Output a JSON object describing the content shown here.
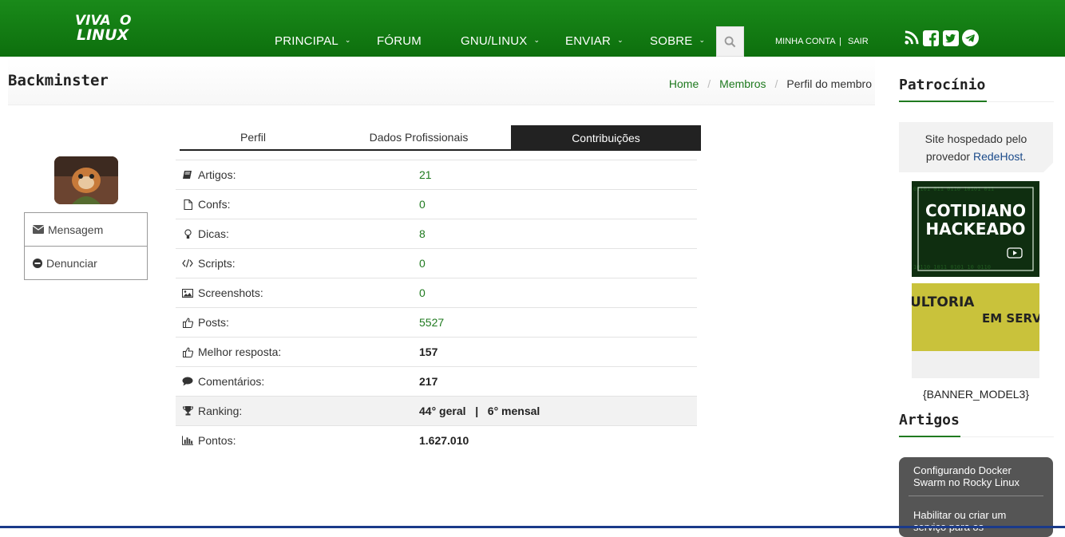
{
  "header": {
    "logo_text": "VIVA O LINUX",
    "nav": [
      {
        "label": "PRINCIPAL",
        "has_menu": true
      },
      {
        "label": "FÓRUM",
        "has_menu": false
      },
      {
        "label": "GNU/LINUX",
        "has_menu": true
      },
      {
        "label": "ENVIAR",
        "has_menu": true
      },
      {
        "label": "SOBRE",
        "has_menu": true
      }
    ],
    "chevron": "⌄",
    "account_label": "MINHA CONTA",
    "account_sep": "|",
    "logout_label": "SAIR",
    "social_icons": [
      "rss-icon",
      "facebook-icon",
      "twitter-icon",
      "telegram-icon"
    ]
  },
  "page": {
    "title": "Backminster",
    "breadcrumb": [
      {
        "label": "Home",
        "link": true
      },
      {
        "label": "Membros",
        "link": true
      },
      {
        "label": "Perfil do membro",
        "link": false
      }
    ],
    "breadcrumb_sep": "/"
  },
  "profile": {
    "message_button": "Mensagem",
    "report_button": "Denunciar"
  },
  "tabs": [
    {
      "label": "Perfil",
      "active": false
    },
    {
      "label": "Dados Profissionais",
      "active": false
    },
    {
      "label": "Contribuições",
      "active": true
    }
  ],
  "stats": [
    {
      "icon": "book-icon",
      "label": "Artigos:",
      "value": "21",
      "link": true
    },
    {
      "icon": "file-icon",
      "label": "Confs:",
      "value": "0",
      "link": true
    },
    {
      "icon": "lightbulb-icon",
      "label": "Dicas:",
      "value": "8",
      "link": true
    },
    {
      "icon": "code-icon",
      "label": "Scripts:",
      "value": "0",
      "link": true
    },
    {
      "icon": "image-icon",
      "label": "Screenshots:",
      "value": "0",
      "link": true
    },
    {
      "icon": "thumbs-up-icon",
      "label": "Posts:",
      "value": "5527",
      "link": true
    },
    {
      "icon": "thumbs-up-icon",
      "label": "Melhor resposta:",
      "value": "157",
      "link": false
    },
    {
      "icon": "comment-icon",
      "label": "Comentários:",
      "value": "217",
      "link": false
    },
    {
      "icon": "trophy-icon",
      "label": "Ranking:",
      "value": "44° geral   |   6° mensal",
      "link": false,
      "highlight": true
    },
    {
      "icon": "bar-chart-icon",
      "label": "Pontos:",
      "value": "1.627.010",
      "link": false
    }
  ],
  "sidebar": {
    "sponsor_heading": "Patrocínio",
    "sponsor_text_1": "Site hospedado pelo",
    "sponsor_text_2": "provedor",
    "sponsor_link": "RedeHost",
    "sponsor_text_end": ".",
    "banner1_line1": "COTIDIANO",
    "banner1_line2": "HACKEADO",
    "banner2_line1": "ULTORIA",
    "banner2_line2": "EM SERVI",
    "banner_model": "{BANNER_MODEL3}",
    "articles_heading": "Artigos",
    "articles": [
      "Configurando Docker Swarm no Rocky Linux",
      "Habilitar ou criar um serviço para os"
    ]
  },
  "colors": {
    "brand_green": "#118011",
    "link_green": "#1f7a1f",
    "dark": "#222222"
  }
}
